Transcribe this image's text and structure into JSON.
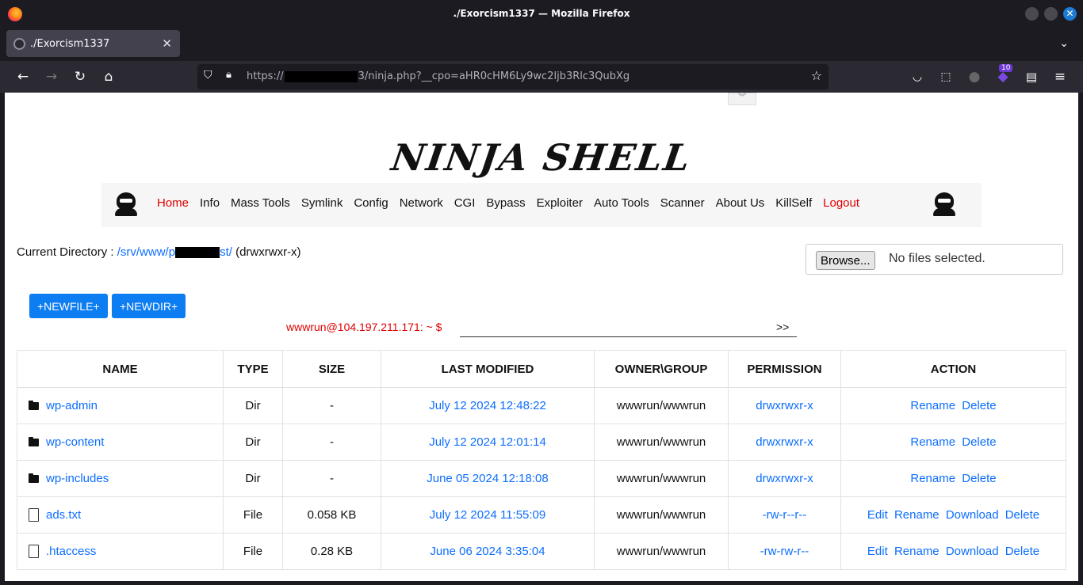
{
  "window": {
    "title": "./Exorcism1337 — Mozilla Firefox"
  },
  "tabs": [
    {
      "label": "./Exorcism1337"
    }
  ],
  "urlbar": {
    "url_prefix": "https://",
    "url_suffix": "3/ninja.php?__cpo=aHR0cHM6Ly9wc2ljb3Rlc3QubXg"
  },
  "extensions": {
    "badge_count": "10"
  },
  "page": {
    "logo": "NINJA SHELL",
    "menu": [
      "Home",
      "Info",
      "Mass Tools",
      "Symlink",
      "Config",
      "Network",
      "CGI",
      "Bypass",
      "Exploiter",
      "Auto Tools",
      "Scanner",
      "About Us",
      "KillSelf",
      "Logout"
    ],
    "current_dir_label": "Current Directory :",
    "dir_parts": [
      "/srv",
      "/www",
      "/p",
      "st/"
    ],
    "dir_perm": "(drwxrwxr-x)",
    "upload": {
      "button": "Browse...",
      "status": "No files selected."
    },
    "newfile_button": "+NEWFILE+",
    "newdir_button": "+NEWDIR+",
    "prompt": "wwwrun@104.197.211.171: ~ $",
    "go_button": ">>",
    "table_headers": [
      "NAME",
      "TYPE",
      "SIZE",
      "LAST MODIFIED",
      "OWNER\\GROUP",
      "PERMISSION",
      "ACTION"
    ],
    "rows": [
      {
        "name": "wp-admin",
        "type": "Dir",
        "size": "-",
        "modified": "July 12 2024 12:48:22",
        "owner": "wwwrun/wwwrun",
        "perm": "drwxrwxr-x",
        "action": "Rename Delete",
        "kind": "folder"
      },
      {
        "name": "wp-content",
        "type": "Dir",
        "size": "-",
        "modified": "July 12 2024 12:01:14",
        "owner": "wwwrun/wwwrun",
        "perm": "drwxrwxr-x",
        "action": "Rename Delete",
        "kind": "folder"
      },
      {
        "name": "wp-includes",
        "type": "Dir",
        "size": "-",
        "modified": "June 05 2024 12:18:08",
        "owner": "wwwrun/wwwrun",
        "perm": "drwxrwxr-x",
        "action": "Rename Delete",
        "kind": "folder"
      },
      {
        "name": "ads.txt",
        "type": "File",
        "size": "0.058 KB",
        "modified": "July 12 2024 11:55:09",
        "owner": "wwwrun/wwwrun",
        "perm": "-rw-r--r--",
        "action": "Edit Rename Download Delete",
        "kind": "file"
      },
      {
        "name": ".htaccess",
        "type": "File",
        "size": "0.28 KB",
        "modified": "June 06 2024 3:35:04",
        "owner": "wwwrun/wwwrun",
        "perm": "-rw-rw-r--",
        "action": "Edit Rename Download Delete",
        "kind": "file"
      }
    ]
  }
}
